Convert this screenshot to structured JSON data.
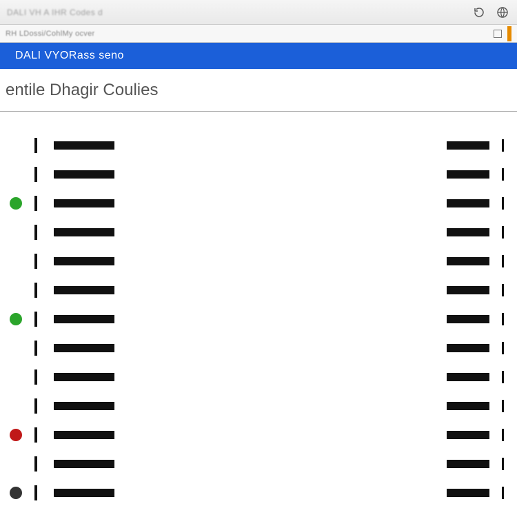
{
  "toolbar": {
    "text": "DALI VH  A  IHR  Codes  d",
    "refresh_icon": "refresh-icon",
    "globe_icon": "globe-icon"
  },
  "addressbar": {
    "path": "RH LDossi/CohlMy  ocver",
    "bookmark_icon": "bookmark-icon"
  },
  "bluebar": {
    "title": "DALI  VYORass seno"
  },
  "heading": {
    "text": "entile  Dhagir Coulies"
  },
  "rows_left": [
    {
      "status": "none"
    },
    {
      "status": "none"
    },
    {
      "status": "green"
    },
    {
      "status": "none"
    },
    {
      "status": "none"
    },
    {
      "status": "none"
    },
    {
      "status": "green"
    },
    {
      "status": "none"
    },
    {
      "status": "none"
    },
    {
      "status": "none"
    },
    {
      "status": "red"
    },
    {
      "status": "none"
    },
    {
      "status": "gray"
    }
  ],
  "rows_right_count": 13,
  "colors": {
    "accent": "#1b5fd9",
    "green": "#2ba52b",
    "red": "#c01818"
  }
}
